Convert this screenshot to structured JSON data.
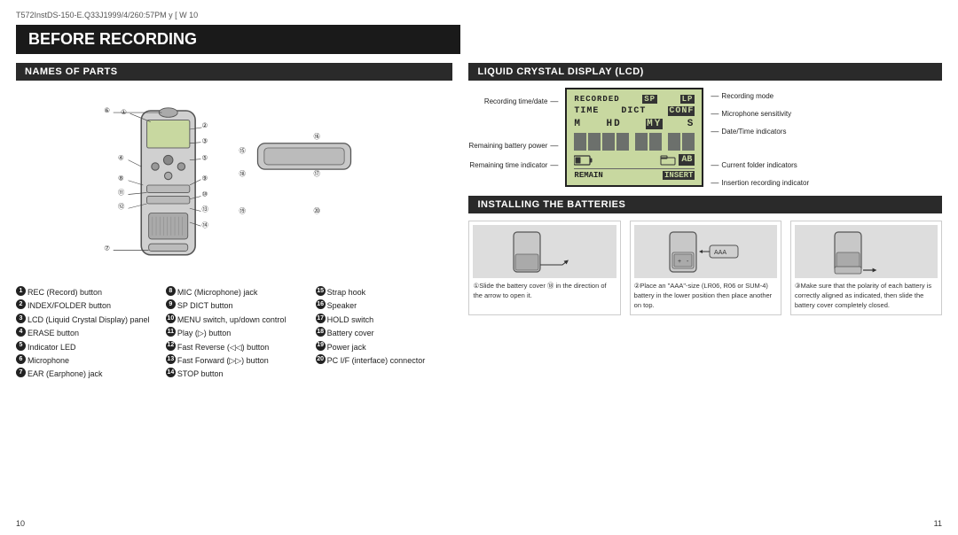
{
  "topbar": {
    "text": "T572InstDS-150-E.Q33J1999/4/260:57PM y [ W 10"
  },
  "main_title": "BEFORE RECORDING",
  "left_section": {
    "header": "NAMES OF PARTS",
    "parts": [
      {
        "num": "1",
        "label": "REC (Record) button"
      },
      {
        "num": "2",
        "label": "INDEX/FOLDER button"
      },
      {
        "num": "3",
        "label": "LCD (Liquid Crystal Display) panel"
      },
      {
        "num": "4",
        "label": "ERASE button"
      },
      {
        "num": "5",
        "label": "Indicator LED"
      },
      {
        "num": "6",
        "label": "Microphone"
      },
      {
        "num": "7",
        "label": "EAR (Earphone) jack"
      },
      {
        "num": "8",
        "label": "MIC (Microphone) jack"
      },
      {
        "num": "9",
        "label": "SP DICT button"
      },
      {
        "num": "10",
        "label": "MENU switch, up/down control"
      },
      {
        "num": "11",
        "label": "Play (▷) button"
      },
      {
        "num": "12",
        "label": "Fast Reverse (◁◁) button"
      },
      {
        "num": "13",
        "label": "Fast Forward (▷▷) button"
      },
      {
        "num": "14",
        "label": "STOP button"
      },
      {
        "num": "15",
        "label": "Strap hook"
      },
      {
        "num": "16",
        "label": "Speaker"
      },
      {
        "num": "17",
        "label": "HOLD switch"
      },
      {
        "num": "18",
        "label": "Battery cover"
      },
      {
        "num": "19",
        "label": "Power jack"
      },
      {
        "num": "20",
        "label": "PC I/F (interface) connector"
      }
    ]
  },
  "right_section": {
    "lcd_header": "LIQUID CRYSTAL DISPLAY (LCD)",
    "lcd": {
      "row1": "RECORDED SP LP",
      "row2": "TIME  DICT  CONF",
      "row3": "M   HD   MY   S",
      "label_recording_time": "Recording time/date",
      "label_recording_mode": "Recording mode",
      "label_mic_sensitivity": "Microphone sensitivity",
      "label_datetime": "Date/Time indicators",
      "label_battery": "Remaining battery power",
      "label_remain_time": "Remaining time indicator",
      "label_folder": "Current folder indicators",
      "label_insertion": "Insertion recording indicator",
      "remain": "REMAIN",
      "insert": "INSERT"
    },
    "battery_header": "INSTALLING THE BATTERIES",
    "steps": [
      {
        "num": "1",
        "caption": "①Slide the battery cover ⑱ in the direction of the arrow to open it."
      },
      {
        "num": "2",
        "caption": "②Place an \"AAA\"-size (LR06, R06 or SUM-4) battery in the lower position then place another on top."
      },
      {
        "num": "3",
        "caption": "③Make sure that the polarity of each battery is correctly aligned as indicated, then slide the battery cover completely closed."
      }
    ]
  },
  "page_numbers": {
    "left": "10",
    "right": "11"
  }
}
